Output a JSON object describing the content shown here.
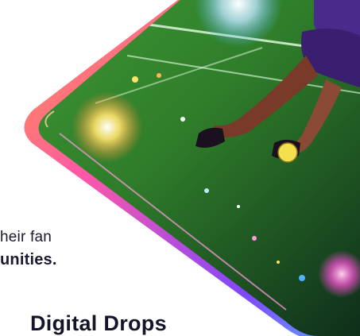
{
  "content": {
    "description_line_1": "heir fan",
    "description_line_2": "unities.",
    "section_heading": "Digital Drops"
  },
  "artwork": {
    "subject": "card-illustration-soccer-player",
    "colors": {
      "frame_pink": "#ff4fa3",
      "frame_purple": "#7a3cff",
      "frame_orange": "#ff9a2e",
      "pitch_green": "#2f7d2a",
      "pitch_dark": "#0d2a1a",
      "light_glow": "#fff5c2",
      "sky_blue": "#4fb3ff",
      "player_kit": "#4a2a8a",
      "ball_yellow": "#f4e04d"
    }
  }
}
